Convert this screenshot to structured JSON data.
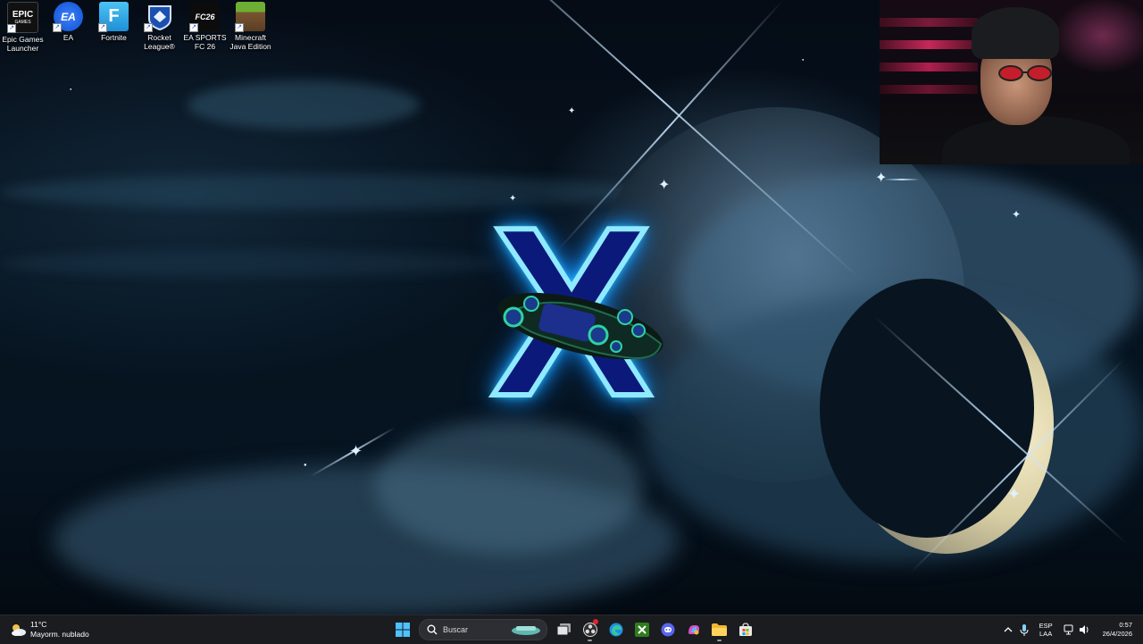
{
  "desktop": {
    "icons": [
      {
        "name": "epic-games-launcher",
        "label": "Epic Games\nLauncher",
        "icon": "epic-games-icon",
        "color": "#111111"
      },
      {
        "name": "ea",
        "label": "EA",
        "icon": "ea-icon",
        "color": "#1b5fe0"
      },
      {
        "name": "fortnite",
        "label": "Fortnite",
        "icon": "fortnite-icon",
        "color": "#27a6e8"
      },
      {
        "name": "rocket-league",
        "label": "Rocket\nLeague®",
        "icon": "rocket-league-icon",
        "color": "#1b4fb0"
      },
      {
        "name": "ea-sports-fc-26",
        "label": "EA SPORTS\nFC 26",
        "icon": "ea-sports-fc-icon",
        "color": "#0c0c0c"
      },
      {
        "name": "minecraft-java",
        "label": "Minecraft\nJava Edition",
        "icon": "minecraft-icon",
        "color": "#5c8f2c"
      }
    ],
    "icon_text": {
      "epic_top": "EPIC",
      "epic_bottom": "GAMES",
      "ea": "EA",
      "fortnite": "F",
      "fc": "FC26"
    }
  },
  "logo": {
    "letter": "X",
    "glow_color": "#36c8ff",
    "fill_color": "#0b1a7a"
  },
  "taskbar": {
    "weather": {
      "temp": "11°C",
      "condition": "Mayorm. nublado",
      "icon": "partly-cloudy-icon"
    },
    "search": {
      "placeholder": "Buscar"
    },
    "apps": [
      {
        "name": "start",
        "icon": "windows-start-icon"
      },
      {
        "name": "task-view",
        "icon": "task-view-icon"
      },
      {
        "name": "obs",
        "icon": "obs-studio-icon"
      },
      {
        "name": "edge",
        "icon": "edge-icon"
      },
      {
        "name": "xbox",
        "icon": "xbox-icon"
      },
      {
        "name": "discord",
        "icon": "discord-icon"
      },
      {
        "name": "copilot",
        "icon": "copilot-icon"
      },
      {
        "name": "file-explorer",
        "icon": "folder-icon"
      },
      {
        "name": "store",
        "icon": "store-icon"
      }
    ],
    "tray": {
      "language_top": "ESP",
      "language_bottom": "LAA",
      "time": "0:57",
      "date": "26/4/2026"
    }
  },
  "colors": {
    "taskbar_bg": "#1b1c20",
    "accent": "#36c8ff"
  }
}
